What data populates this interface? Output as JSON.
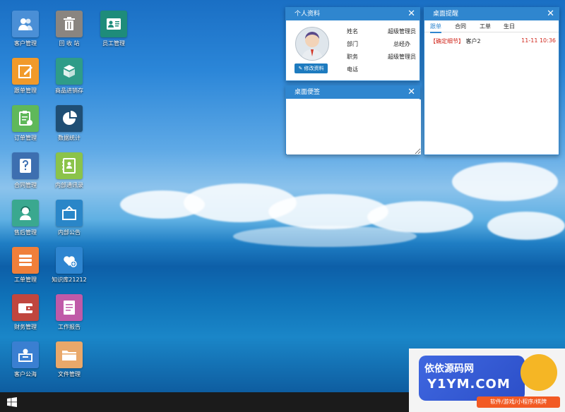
{
  "desktop_icons": [
    {
      "label": "客户管理",
      "icon": "customer-icon",
      "color": "#4a8fd6"
    },
    {
      "label": "回 收 站",
      "icon": "trash-icon",
      "color": "#8a8580"
    },
    {
      "label": "员工管理",
      "icon": "employee-card-icon",
      "color": "#1e8c7a"
    },
    {
      "label": "跟单管理",
      "icon": "edit-icon",
      "color": "#f19a2a"
    },
    {
      "label": "商品进销存",
      "icon": "box-icon",
      "color": "#2f9c88"
    },
    {
      "label": "订单管理",
      "icon": "order-icon",
      "color": "#5fb85a"
    },
    {
      "label": "数据统计",
      "icon": "pie-chart-icon",
      "color": "#1f4e74"
    },
    {
      "label": "合同管理",
      "icon": "contract-icon",
      "color": "#3d6fb0"
    },
    {
      "label": "内部通讯录",
      "icon": "address-book-icon",
      "color": "#8bc34a"
    },
    {
      "label": "售后管理",
      "icon": "support-icon",
      "color": "#3aa88f"
    },
    {
      "label": "内部公告",
      "icon": "notice-icon",
      "color": "#2a86c8"
    },
    {
      "label": "工单管理",
      "icon": "list-icon",
      "color": "#f07f3a"
    },
    {
      "label": "知识库21212",
      "icon": "heart-plus-icon",
      "color": "#2e85d0"
    },
    {
      "label": "财务管理",
      "icon": "wallet-icon",
      "color": "#c0463e"
    },
    {
      "label": "工作报告",
      "icon": "report-icon",
      "color": "#c05aa8"
    },
    {
      "label": "客户公海",
      "icon": "public-customer-icon",
      "color": "#3a7fd1"
    },
    {
      "label": "文件管理",
      "icon": "folder-icon",
      "color": "#e9a86a"
    }
  ],
  "profile_panel": {
    "title": "个人资料",
    "edit_label": "修改资料",
    "rows": [
      {
        "key": "姓名",
        "value": "超级管理员"
      },
      {
        "key": "部门",
        "value": "总经办"
      },
      {
        "key": "职务",
        "value": "超级管理员"
      },
      {
        "key": "电话",
        "value": ""
      }
    ]
  },
  "reminder_panel": {
    "title": "桌面提醒",
    "tabs": [
      "跟单",
      "合同",
      "工单",
      "生日"
    ],
    "active_tab": "跟单",
    "items": [
      {
        "tag": "【确定细节】",
        "customer": "客户2",
        "time": "11-11 10:36"
      }
    ]
  },
  "note_panel": {
    "title": "桌面便签",
    "content": ""
  },
  "taskbar": {
    "start": "windows-start-icon"
  },
  "watermark": {
    "title": "依依源码网",
    "domain": "Y1YM.COM",
    "tagline": "软件/游戏/小程序/棋牌"
  },
  "colors": {
    "panel_header": "#2f86cf",
    "accent_red": "#d0271c",
    "active_tab": "#2f86cf"
  }
}
